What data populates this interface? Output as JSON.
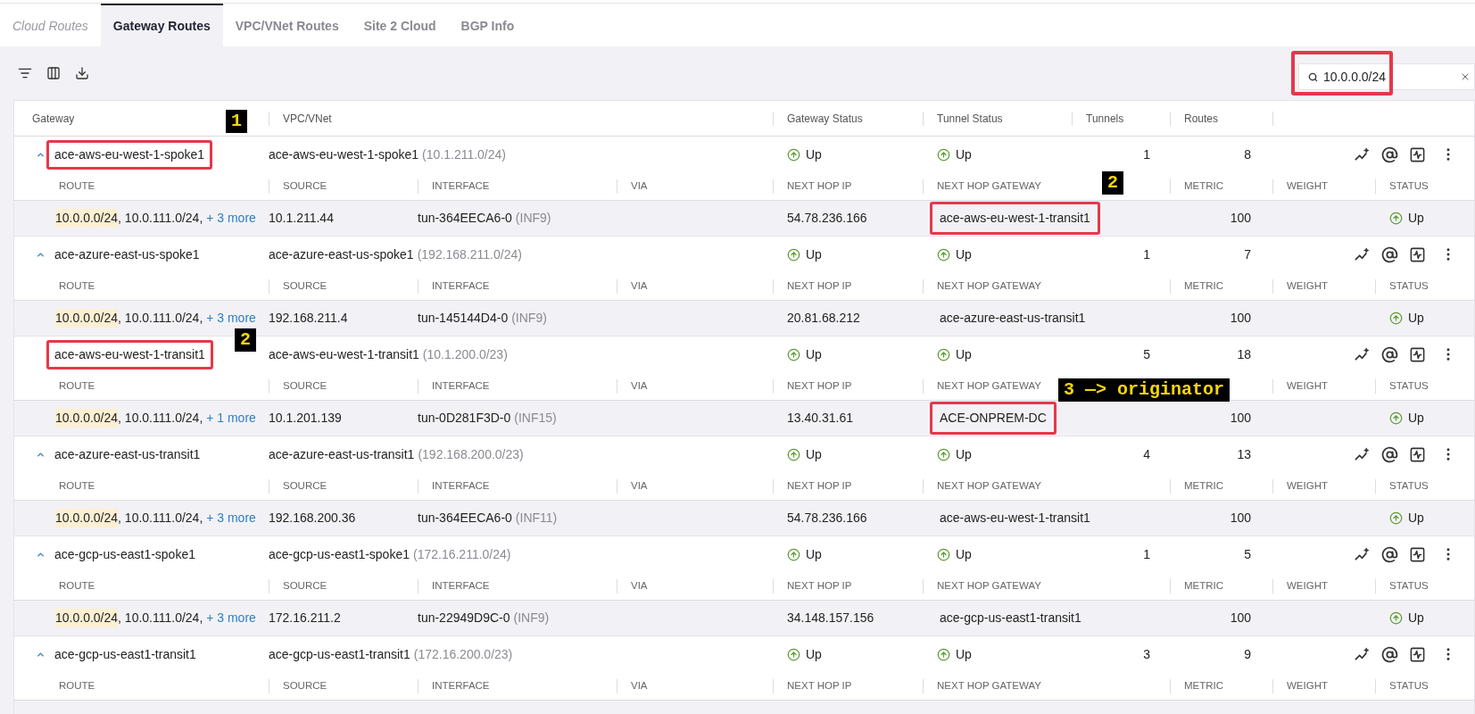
{
  "tabs": [
    {
      "label": "Cloud Routes",
      "selected": false,
      "disabled": true
    },
    {
      "label": "Gateway Routes",
      "selected": true,
      "disabled": false
    },
    {
      "label": "VPC/VNet Routes",
      "selected": false,
      "disabled": false
    },
    {
      "label": "Site 2 Cloud",
      "selected": false,
      "disabled": false
    },
    {
      "label": "BGP Info",
      "selected": false,
      "disabled": false
    }
  ],
  "search": {
    "value": "10.0.0.0/24",
    "outlined": true
  },
  "table": {
    "columns": [
      "Gateway",
      "VPC/VNet",
      "Gateway Status",
      "Tunnel Status",
      "Tunnels",
      "Routes"
    ],
    "groups": [
      {
        "name": "ace-aws-eu-west-1-spoke1",
        "outlined": true,
        "expanded": true,
        "vpc": "ace-aws-eu-west-1-spoke1",
        "cidr": "(10.1.211.0/24)",
        "gateway_status": "Up",
        "tunnel_status": "Up",
        "tunnels": "1",
        "routes": "8",
        "route_columns": {
          "route": "ROUTE",
          "source": "SOURCE",
          "interface": "INTERFACE",
          "via": "VIA",
          "next_hop_ip": "NEXT HOP IP",
          "next_hop_gateway": "NEXT HOP GATEWAY",
          "metric": "METRIC",
          "weight": "WEIGHT",
          "status": "STATUS"
        },
        "route": {
          "matched": "10.0.0.0/24",
          "rest": ", 10.0.111.0/24, ",
          "more": "+ 3 more",
          "source": "10.1.211.44",
          "interface": "tun-364EECA6-0",
          "interface_id": "(INF9)",
          "next_hop_ip": "54.78.236.166",
          "next_hop_gateway": "ace-aws-eu-west-1-transit1",
          "gateway_outlined": true,
          "metric": "100",
          "status": "Up"
        }
      },
      {
        "name": "ace-azure-east-us-spoke1",
        "outlined": false,
        "expanded": true,
        "vpc": "ace-azure-east-us-spoke1",
        "cidr": "(192.168.211.0/24)",
        "gateway_status": "Up",
        "tunnel_status": "Up",
        "tunnels": "1",
        "routes": "7",
        "route_columns": {
          "route": "ROUTE",
          "source": "SOURCE",
          "interface": "INTERFACE",
          "via": "VIA",
          "next_hop_ip": "NEXT HOP IP",
          "next_hop_gateway": "NEXT HOP GATEWAY",
          "metric": "METRIC",
          "weight": "WEIGHT",
          "status": "STATUS"
        },
        "route": {
          "matched": "10.0.0.0/24",
          "rest": ", 10.0.111.0/24, ",
          "more": "+ 3 more",
          "source": "192.168.211.4",
          "interface": "tun-145144D4-0",
          "interface_id": "(INF9)",
          "next_hop_ip": "20.81.68.212",
          "next_hop_gateway": "ace-azure-east-us-transit1",
          "gateway_outlined": false,
          "metric": "100",
          "status": "Up"
        }
      },
      {
        "name": "ace-aws-eu-west-1-transit1",
        "outlined": true,
        "vpc": "ace-aws-eu-west-1-transit1",
        "cidr": "(10.1.200.0/23)",
        "gateway_status": "Up",
        "tunnel_status": "Up",
        "tunnels": "5",
        "routes": "18",
        "route_columns": {
          "route": "ROUTE",
          "source": "SOURCE",
          "interface": "INTERFACE",
          "via": "VIA",
          "next_hop_ip": "NEXT HOP IP",
          "next_hop_gateway": "NEXT HOP GATEWAY",
          "weight": "WEIGHT",
          "status": "STATUS"
        },
        "route": {
          "matched": "10.0.0.0/24",
          "rest": ", 10.0.111.0/24, ",
          "more": "+ 1 more",
          "source": "10.1.201.139",
          "interface": "tun-0D281F3D-0",
          "interface_id": "(INF15)",
          "next_hop_ip": "13.40.31.61",
          "next_hop_gateway": "ACE-ONPREM-DC",
          "gateway_outlined": true,
          "metric": "100",
          "status": "Up"
        }
      },
      {
        "name": "ace-azure-east-us-transit1",
        "outlined": false,
        "expanded": true,
        "vpc": "ace-azure-east-us-transit1",
        "cidr": "(192.168.200.0/23)",
        "gateway_status": "Up",
        "tunnel_status": "Up",
        "tunnels": "4",
        "routes": "13",
        "route_columns": {
          "route": "ROUTE",
          "source": "SOURCE",
          "interface": "INTERFACE",
          "via": "VIA",
          "next_hop_ip": "NEXT HOP IP",
          "next_hop_gateway": "NEXT HOP GATEWAY",
          "metric": "METRIC",
          "weight": "WEIGHT",
          "status": "STATUS"
        },
        "route": {
          "matched": "10.0.0.0/24",
          "rest": ", 10.0.111.0/24, ",
          "more": "+ 3 more",
          "source": "192.168.200.36",
          "interface": "tun-364EECA6-0",
          "interface_id": "(INF11)",
          "next_hop_ip": "54.78.236.166",
          "next_hop_gateway": "ace-aws-eu-west-1-transit1",
          "gateway_outlined": false,
          "metric": "100",
          "status": "Up"
        }
      },
      {
        "name": "ace-gcp-us-east1-spoke1",
        "outlined": false,
        "expanded": true,
        "vpc": "ace-gcp-us-east1-spoke1",
        "cidr": "(172.16.211.0/24)",
        "gateway_status": "Up",
        "tunnel_status": "Up",
        "tunnels": "1",
        "routes": "5",
        "route_columns": {
          "route": "ROUTE",
          "source": "SOURCE",
          "interface": "INTERFACE",
          "via": "VIA",
          "next_hop_ip": "NEXT HOP IP",
          "next_hop_gateway": "NEXT HOP GATEWAY",
          "metric": "METRIC",
          "weight": "WEIGHT",
          "status": "STATUS"
        },
        "route": {
          "matched": "10.0.0.0/24",
          "rest": ", 10.0.111.0/24, ",
          "more": "+ 3 more",
          "source": "172.16.211.2",
          "interface": "tun-22949D9C-0",
          "interface_id": "(INF9)",
          "next_hop_ip": "34.148.157.156",
          "next_hop_gateway": "ace-gcp-us-east1-transit1",
          "gateway_outlined": false,
          "metric": "100",
          "status": "Up"
        }
      },
      {
        "name": "ace-gcp-us-east1-transit1",
        "outlined": false,
        "expanded": true,
        "vpc": "ace-gcp-us-east1-transit1",
        "cidr": "(172.16.200.0/23)",
        "gateway_status": "Up",
        "tunnel_status": "Up",
        "tunnels": "3",
        "routes": "9",
        "route_columns": {
          "route": "ROUTE",
          "source": "SOURCE",
          "interface": "INTERFACE",
          "via": "VIA",
          "next_hop_ip": "NEXT HOP IP",
          "next_hop_gateway": "NEXT HOP GATEWAY",
          "metric": "METRIC",
          "weight": "WEIGHT",
          "status": "STATUS"
        }
      }
    ]
  },
  "annotations": [
    {
      "text": "1"
    },
    {
      "text": "2"
    },
    {
      "text": "2"
    },
    {
      "text": "3 —> originator"
    }
  ]
}
